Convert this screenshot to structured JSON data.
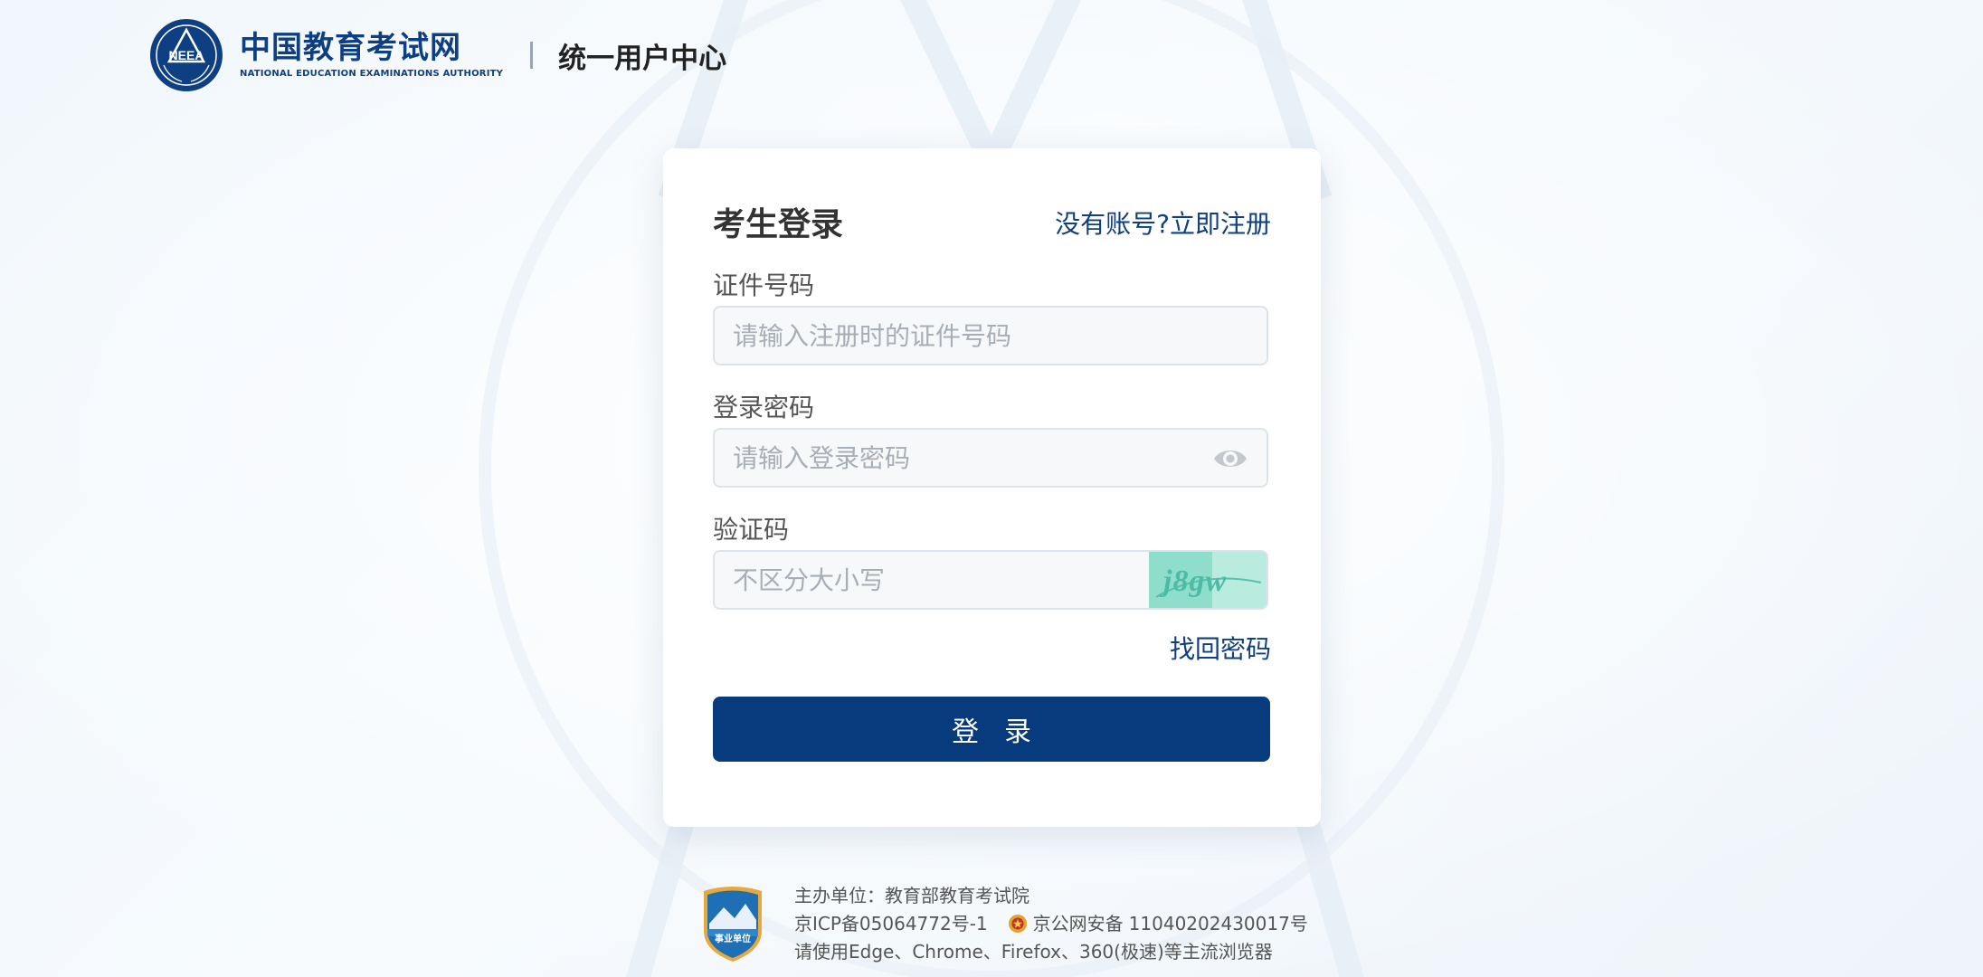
{
  "header": {
    "logo_cn": "中国教育考试网",
    "logo_en": "NATIONAL EDUCATION EXAMINATIONS AUTHORITY",
    "logo_emblem_text": "NEEA",
    "subtitle": "统一用户中心"
  },
  "login": {
    "title": "考生登录",
    "register_link": "没有账号?立即注册",
    "id_label": "证件号码",
    "id_placeholder": "请输入注册时的证件号码",
    "password_label": "登录密码",
    "password_placeholder": "请输入登录密码",
    "captcha_label": "验证码",
    "captcha_placeholder": "不区分大小写",
    "captcha_text": "j8gw",
    "forgot_link": "找回密码",
    "submit_label": "登录"
  },
  "footer": {
    "sponsor": "主办单位：教育部教育考试院",
    "icp": "京ICP备05064772号-1",
    "police_prefix": "京公网安备",
    "police_number": "11040202430017号",
    "browser_note": "请使用Edge、Chrome、Firefox、360(极速)等主流浏览器",
    "badge_text": "事业单位"
  },
  "colors": {
    "brand_blue": "#073b7d",
    "link_blue": "#0f3f7e",
    "captcha_green": "#7ed9c8"
  },
  "icons": {
    "password_toggle": "eye-icon",
    "police": "police-badge-icon",
    "public_institution": "institution-badge-icon"
  }
}
